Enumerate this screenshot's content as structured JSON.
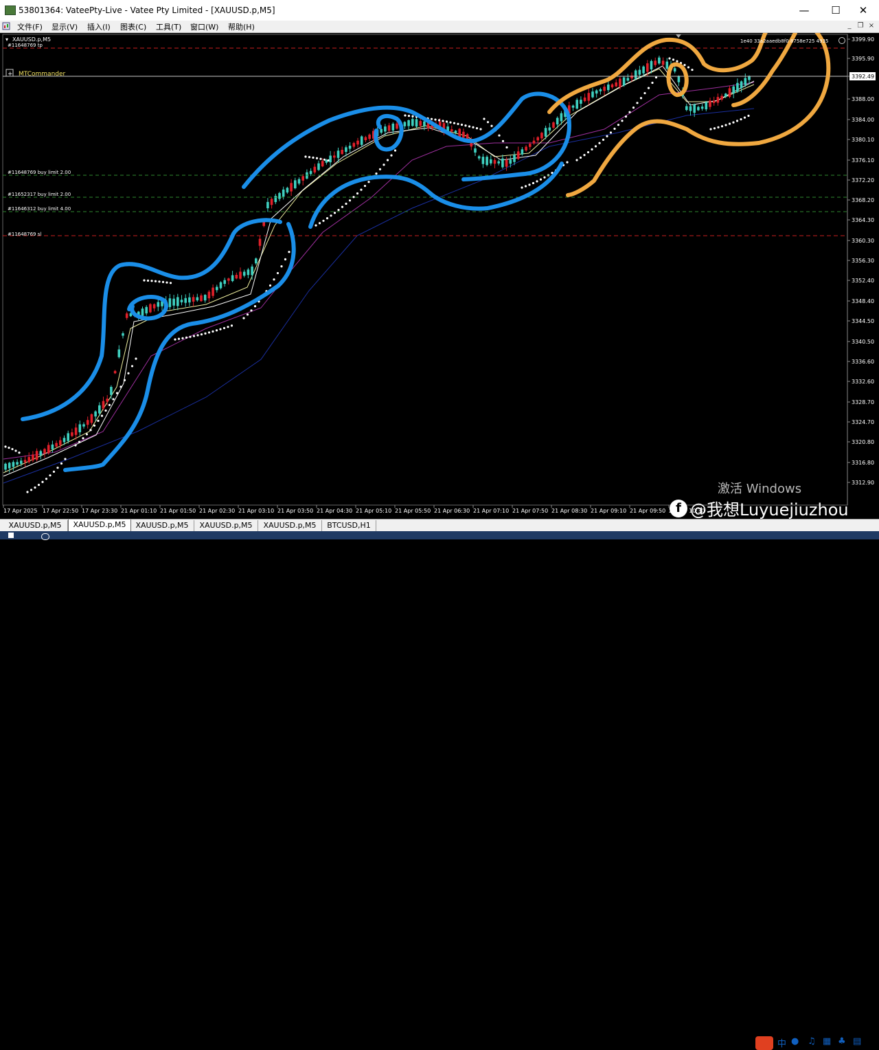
{
  "window": {
    "title": "53801364: VateePty-Live - Vatee Pty Limited - [XAUUSD.p,M5]",
    "min_symbol": "—",
    "max_symbol": "☐",
    "close_symbol": "✕"
  },
  "menu": {
    "items": [
      "文件(F)",
      "显示(V)",
      "插入(I)",
      "图表(C)",
      "工具(T)",
      "窗口(W)",
      "帮助(H)"
    ]
  },
  "chart": {
    "symbol_label": "XAUUSD.p,M5",
    "plugin_label": "MTCommander",
    "top_right_id": "1e40 33a2aaedb8f0 8758e725  4935",
    "tp_label": "#11648769 tp",
    "sl_label": "#11648769 sl",
    "current_price": "3392.49",
    "price_ticks": [
      "3399.90",
      "3395.90",
      "3392.49",
      "3388.00",
      "3384.00",
      "3380.10",
      "3376.10",
      "3372.20",
      "3368.20",
      "3364.30",
      "3360.30",
      "3356.30",
      "3352.40",
      "3348.40",
      "3344.50",
      "3340.50",
      "3336.60",
      "3332.60",
      "3328.70",
      "3324.70",
      "3320.80",
      "3316.80",
      "3312.90"
    ],
    "time_ticks": [
      "17 Apr 2025",
      "17 Apr 22:50",
      "17 Apr 23:30",
      "21 Apr 01:10",
      "21 Apr 01:50",
      "21 Apr 02:30",
      "21 Apr 03:10",
      "21 Apr 03:50",
      "21 Apr 04:30",
      "21 Apr 05:10",
      "21 Apr 05:50",
      "21 Apr 06:30",
      "21 Apr 07:10",
      "21 Apr 07:50",
      "21 Apr 08:30",
      "21 Apr 09:10",
      "21 Apr 09:50",
      "21 Apr 10:30"
    ],
    "order_lines": [
      {
        "label": "#11648769 buy limit 2.00"
      },
      {
        "label": "#11652317 buy limit 2.00"
      },
      {
        "label": "#11646312 buy limit 4.00"
      }
    ],
    "colors": {
      "bull": "#3fd0c0",
      "bear": "#e0202a",
      "tp_line": "#cc2020",
      "order_line": "#2f8a2f",
      "ma_slow": "#1a2fa0",
      "ma_mid": "#a030a0",
      "ma_fast1": "#f0f0a0",
      "ma_fast2": "#ffffff",
      "psar": "#ffffff",
      "annot_blue": "#1a8ee8",
      "annot_orange": "#f0a840"
    }
  },
  "tabs": [
    "XAUUSD.p,M5",
    "XAUUSD.p,M5",
    "XAUUSD.p,M5",
    "XAUUSD.p,M5",
    "XAUUSD.p,M5",
    "BTCUSD,H1"
  ],
  "watermark": "激活 Windows",
  "credit": "@我想Luyuejiuzhou",
  "ime_text": "中"
}
